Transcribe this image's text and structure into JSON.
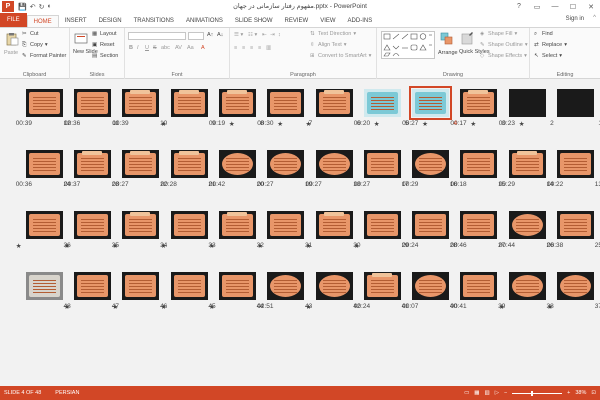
{
  "window": {
    "title": "مفهوم رفتار سازمانی در جهان.pptx - PowerPoint",
    "app_letter": "P",
    "qat": [
      "💾",
      "↶",
      "↻",
      "◐"
    ],
    "controls": [
      "?",
      "▭",
      "—",
      "☐",
      "✕"
    ]
  },
  "tabs": [
    "FILE",
    "HOME",
    "INSERT",
    "DESIGN",
    "TRANSITIONS",
    "ANIMATIONS",
    "SLIDE SHOW",
    "REVIEW",
    "VIEW",
    "ADD-INS"
  ],
  "active_tab": "HOME",
  "signin": "Sign in",
  "ribbon": {
    "clipboard": {
      "label": "Clipboard",
      "paste": "Paste",
      "cut": "Cut",
      "copy": "Copy",
      "format_painter": "Format Painter"
    },
    "slides": {
      "label": "Slides",
      "new_slide": "New Slide",
      "layout": "Layout",
      "reset": "Reset",
      "section": "Section"
    },
    "font": {
      "label": "Font",
      "bold": "B",
      "italic": "I",
      "underline": "U",
      "strike": "S",
      "shadow": "abc",
      "spacing": "AV",
      "case": "Aa",
      "color": "A"
    },
    "paragraph": {
      "label": "Paragraph",
      "text_direction": "Text Direction",
      "align_text": "Align Text",
      "smartart": "Convert to SmartArt"
    },
    "drawing": {
      "label": "Drawing",
      "arrange": "Arrange",
      "quick_styles": "Quick Styles",
      "shape_fill": "Shape Fill",
      "shape_outline": "Shape Outline",
      "shape_effects": "Shape Effects"
    },
    "editing": {
      "label": "Editing",
      "find": "Find",
      "replace": "Replace",
      "select": "Select"
    }
  },
  "slides": [
    {
      "n": "1",
      "time": "",
      "star": false,
      "style": "first"
    },
    {
      "n": "2",
      "time": "00:23",
      "star": true,
      "style": "first"
    },
    {
      "n": "3",
      "time": "00:17",
      "star": true,
      "style": "tag"
    },
    {
      "n": "4",
      "time": "00:27",
      "star": true,
      "style": "teal",
      "selected": true
    },
    {
      "n": "5",
      "time": "00:20",
      "star": true,
      "style": "teal"
    },
    {
      "n": "6",
      "time": "",
      "star": true,
      "style": "tag"
    },
    {
      "n": "7",
      "time": "00:30",
      "star": true,
      "style": "plain"
    },
    {
      "n": "8",
      "time": "00:19",
      "star": true,
      "style": "tag"
    },
    {
      "n": "9",
      "time": "",
      "star": true,
      "style": "tag"
    },
    {
      "n": "10",
      "time": "00:39",
      "star": false,
      "style": "tag"
    },
    {
      "n": "11",
      "time": "00:36",
      "star": false,
      "style": "plain"
    },
    {
      "n": "12",
      "time": "00:39",
      "star": false,
      "style": "plain"
    },
    {
      "n": "13",
      "time": "00:22",
      "star": false,
      "style": "plain"
    },
    {
      "n": "14",
      "time": "00:29",
      "star": false,
      "style": "tag"
    },
    {
      "n": "15",
      "time": "00:18",
      "star": false,
      "style": "plain"
    },
    {
      "n": "16",
      "time": "00:29",
      "star": false,
      "style": "oval"
    },
    {
      "n": "17",
      "time": "00:27",
      "star": false,
      "style": "plain"
    },
    {
      "n": "18",
      "time": "00:27",
      "star": false,
      "style": "oval"
    },
    {
      "n": "19",
      "time": "00:27",
      "star": false,
      "style": "oval"
    },
    {
      "n": "20",
      "time": "00:42",
      "star": false,
      "style": "oval"
    },
    {
      "n": "21",
      "time": "00:28",
      "star": false,
      "style": "tag"
    },
    {
      "n": "22",
      "time": "00:27",
      "star": false,
      "style": "tag"
    },
    {
      "n": "23",
      "time": "00:37",
      "star": false,
      "style": "tag"
    },
    {
      "n": "24",
      "time": "00:36",
      "star": false,
      "style": "plain"
    },
    {
      "n": "25",
      "time": "00:38",
      "star": false,
      "style": "plain"
    },
    {
      "n": "26",
      "time": "00:44",
      "star": false,
      "style": "oval"
    },
    {
      "n": "27",
      "time": "00:46",
      "star": false,
      "style": "plain"
    },
    {
      "n": "28",
      "time": "00:24",
      "star": false,
      "style": "plain"
    },
    {
      "n": "29",
      "time": "",
      "star": true,
      "style": "plain"
    },
    {
      "n": "30",
      "time": "",
      "star": true,
      "style": "tag"
    },
    {
      "n": "31",
      "time": "",
      "star": true,
      "style": "plain"
    },
    {
      "n": "32",
      "time": "",
      "star": true,
      "style": "tag"
    },
    {
      "n": "33",
      "time": "",
      "star": true,
      "style": "plain"
    },
    {
      "n": "34",
      "time": "",
      "star": true,
      "style": "tag"
    },
    {
      "n": "35",
      "time": "",
      "star": true,
      "style": "plain"
    },
    {
      "n": "36",
      "time": "",
      "star": true,
      "style": "plain"
    },
    {
      "n": "37",
      "time": "",
      "star": true,
      "style": "oval"
    },
    {
      "n": "38",
      "time": "",
      "star": true,
      "style": "oval"
    },
    {
      "n": "39",
      "time": "00:41",
      "star": false,
      "style": "plain"
    },
    {
      "n": "40",
      "time": "00:07",
      "star": false,
      "style": "oval"
    },
    {
      "n": "41",
      "time": "00:24",
      "star": false,
      "style": "tag"
    },
    {
      "n": "42",
      "time": "",
      "star": true,
      "style": "oval"
    },
    {
      "n": "43",
      "time": "02:51",
      "star": false,
      "style": "oval"
    },
    {
      "n": "44",
      "time": "",
      "star": true,
      "style": "plain"
    },
    {
      "n": "45",
      "time": "",
      "star": true,
      "style": "plain"
    },
    {
      "n": "46",
      "time": "",
      "star": true,
      "style": "plain"
    },
    {
      "n": "47",
      "time": "",
      "star": true,
      "style": "plain"
    },
    {
      "n": "48",
      "time": "",
      "star": false,
      "style": "photo"
    }
  ],
  "star_glyph": "★",
  "status": {
    "slide": "SLIDE 4 OF 48",
    "language": "PERSIAN",
    "zoom": "38%",
    "zoom_fraction": 0.38,
    "zoom_minus": "−",
    "zoom_plus": "+",
    "fit": "⊡"
  },
  "colors": {
    "accent": "#d24726",
    "slide_bg": "#1a1a1a",
    "card": "#e89669"
  }
}
